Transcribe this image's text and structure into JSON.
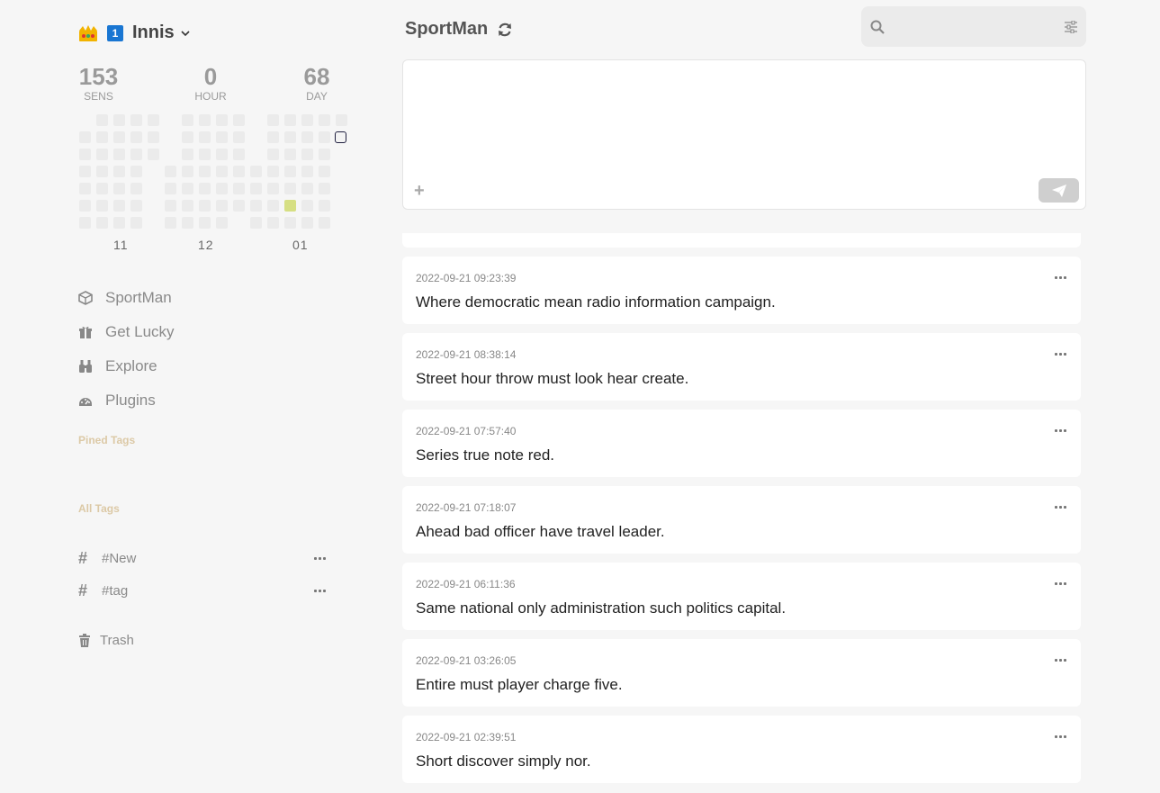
{
  "user": {
    "name": "Innis",
    "badge": "1"
  },
  "stats": [
    {
      "value": "153",
      "label": "SENS"
    },
    {
      "value": "0",
      "label": "HOUR"
    },
    {
      "value": "68",
      "label": "DAY"
    }
  ],
  "heatmap_months": [
    "11",
    "12",
    "01"
  ],
  "nav": [
    {
      "label": "SportMan",
      "icon": "cube-icon"
    },
    {
      "label": "Get Lucky",
      "icon": "gift-icon"
    },
    {
      "label": "Explore",
      "icon": "binoculars-icon"
    },
    {
      "label": "Plugins",
      "icon": "gauge-icon"
    }
  ],
  "pinned_tags_title": "Pined Tags",
  "all_tags_title": "All Tags",
  "tags": [
    "#New",
    "#tag"
  ],
  "trash_label": "Trash",
  "header": {
    "title": "SportMan"
  },
  "search": {
    "placeholder": ""
  },
  "editor": {
    "placeholder": ""
  },
  "memos": [
    {
      "time": "2022-09-21 09:23:39",
      "text": "Where democratic mean radio information campaign."
    },
    {
      "time": "2022-09-21 08:38:14",
      "text": "Street hour throw must look hear create."
    },
    {
      "time": "2022-09-21 07:57:40",
      "text": "Series true note red."
    },
    {
      "time": "2022-09-21 07:18:07",
      "text": "Ahead bad officer have travel leader."
    },
    {
      "time": "2022-09-21 06:11:36",
      "text": "Same national only administration such politics capital."
    },
    {
      "time": "2022-09-21 03:26:05",
      "text": "Entire must player charge five."
    },
    {
      "time": "2022-09-21 02:39:51",
      "text": "Short discover simply nor."
    }
  ],
  "colors": {
    "accent_tag_title": "#dcc9a6",
    "heat_active": "#d6df83",
    "heat_empty": "#ebebeb"
  }
}
